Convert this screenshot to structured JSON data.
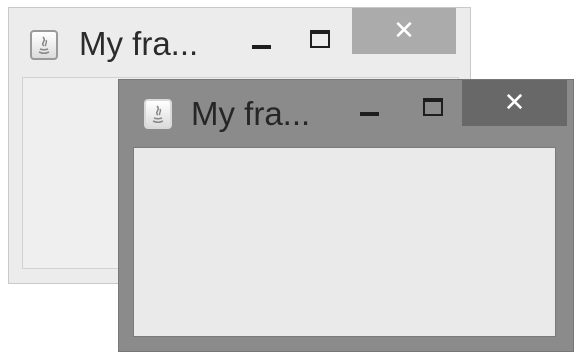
{
  "windows": [
    {
      "title": "My fra...",
      "focused": false,
      "controls": {
        "minimize": "–",
        "maximize": "□",
        "close": "✕"
      }
    },
    {
      "title": "My fra...",
      "focused": true,
      "controls": {
        "minimize": "–",
        "maximize": "□",
        "close": "✕"
      }
    }
  ],
  "icons": [
    "java-app-icon",
    "minimize-icon",
    "maximize-icon",
    "close-icon"
  ],
  "colors": {
    "inactive_titlebar": "#ececec",
    "active_titlebar": "#8b8b8b",
    "inactive_close": "#ababab",
    "active_close": "#686868",
    "client_area": "#eaeaea"
  }
}
